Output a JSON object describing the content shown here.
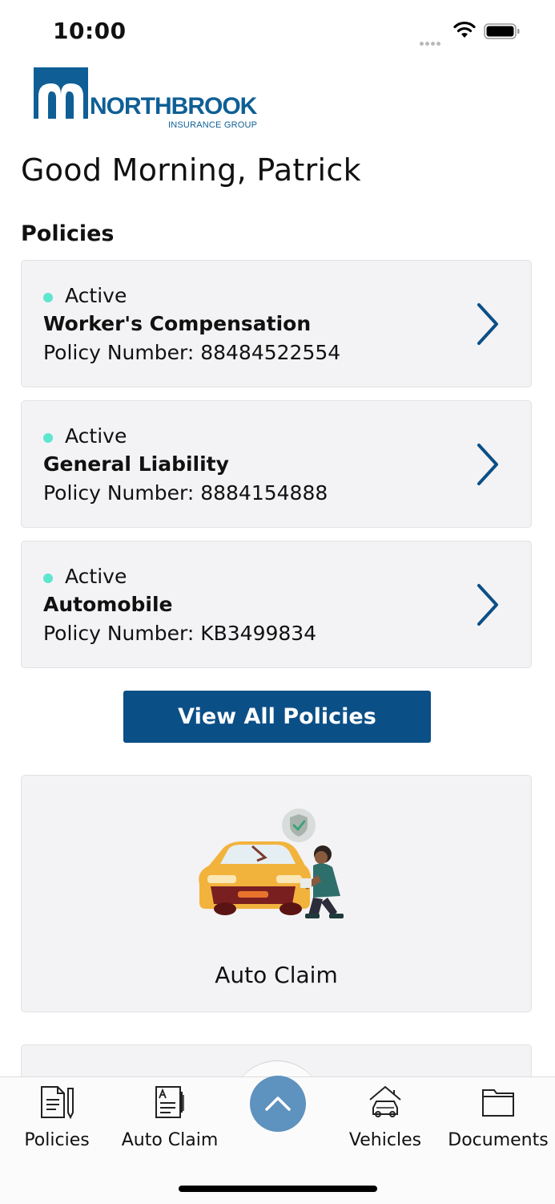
{
  "status_bar": {
    "time": "10:00"
  },
  "logo": {
    "name": "NORTHBROOK",
    "tagline": "INSURANCE GROUP"
  },
  "greeting": "Good Morning, Patrick",
  "policies": {
    "section_title": "Policies",
    "items": [
      {
        "status": "Active",
        "name": "Worker's Compensation",
        "number": "Policy Number: 88484522554"
      },
      {
        "status": "Active",
        "name": "General Liability",
        "number": "Policy Number: 8884154888"
      },
      {
        "status": "Active",
        "name": "Automobile",
        "number": "Policy Number: KB3499834"
      }
    ],
    "view_all_label": "View All Policies"
  },
  "claim_card": {
    "label": "Auto Claim"
  },
  "bottom_nav": {
    "items": [
      {
        "label": "Policies",
        "icon": "policy-document-icon"
      },
      {
        "label": "Auto Claim",
        "icon": "claim-form-icon"
      },
      {
        "label": "Vehicles",
        "icon": "garage-car-icon"
      },
      {
        "label": "Documents",
        "icon": "folder-icon"
      }
    ],
    "center_icon": "chevron-up-icon"
  },
  "colors": {
    "brand_blue": "#0b4f87",
    "active_dot": "#5ee6cf",
    "card_bg": "#f3f3f5",
    "center_button": "#5e92bf"
  }
}
